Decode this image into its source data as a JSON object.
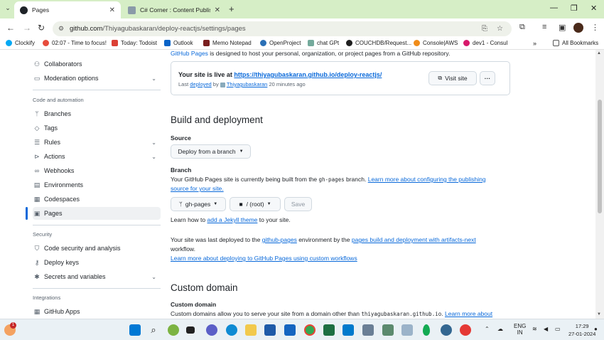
{
  "browser": {
    "tabs": [
      {
        "label": "Pages",
        "active": true
      },
      {
        "label": "C# Corner : Content Publisher",
        "active": false
      }
    ],
    "url_prefix": "github.com",
    "url_path": "/Thiyagubaskaran/deploy-reactjs/settings/pages",
    "bookmarks": [
      "Clockify",
      "02:07 - Time to focus!",
      "Today: Todoist",
      "Outlook",
      "Memo Notepad",
      "OpenProject",
      "chat GPt",
      "COUCHDB/Request...",
      "Console|AWS",
      "dev1 - Consul"
    ],
    "all_bookmarks": "All Bookmarks"
  },
  "sidebar": {
    "top_items": [
      {
        "label": "Collaborators",
        "icon": "people-icon",
        "chevron": false
      },
      {
        "label": "Moderation options",
        "icon": "comment-icon",
        "chevron": true
      }
    ],
    "code_heading": "Code and automation",
    "code_items": [
      {
        "label": "Branches",
        "icon": "branch-icon",
        "chevron": false
      },
      {
        "label": "Tags",
        "icon": "tag-icon",
        "chevron": false
      },
      {
        "label": "Rules",
        "icon": "rules-icon",
        "chevron": true
      },
      {
        "label": "Actions",
        "icon": "play-icon",
        "chevron": true
      },
      {
        "label": "Webhooks",
        "icon": "webhook-icon",
        "chevron": false
      },
      {
        "label": "Environments",
        "icon": "server-icon",
        "chevron": false
      },
      {
        "label": "Codespaces",
        "icon": "codespaces-icon",
        "chevron": false
      },
      {
        "label": "Pages",
        "icon": "browser-icon",
        "chevron": false,
        "selected": true
      }
    ],
    "security_heading": "Security",
    "security_items": [
      {
        "label": "Code security and analysis",
        "icon": "shield-icon",
        "chevron": false
      },
      {
        "label": "Deploy keys",
        "icon": "key-icon",
        "chevron": false
      },
      {
        "label": "Secrets and variables",
        "icon": "asterisk-icon",
        "chevron": true
      }
    ],
    "integrations_heading": "Integrations",
    "integration_items": [
      {
        "label": "GitHub Apps",
        "icon": "apps-icon",
        "chevron": false
      }
    ]
  },
  "main": {
    "cutoff_link": "GitHub Pages",
    "cutoff_text": " is designed to host your personal, organization, or project pages from a GitHub repository.",
    "live_prefix": "Your site is live at ",
    "live_url": "https://thiyagubaskaran.github.io/deploy-reactjs/",
    "meta_last": "Last ",
    "meta_deployed": "deployed",
    "meta_by": " by ",
    "meta_user": "Thiyagubaskaran",
    "meta_time": " 20 minutes ago",
    "visit_site": "Visit site",
    "more": "···",
    "build_heading": "Build and deployment",
    "source_label": "Source",
    "source_value": "Deploy from a branch",
    "branch_label": "Branch",
    "branch_text_1": "Your GitHub Pages site is currently being built from the ",
    "branch_code": "gh-pages",
    "branch_text_2": " branch. ",
    "branch_link": "Learn more about configuring the publishing source for your site.",
    "branch_select": "gh-pages",
    "folder_select": "/ (root)",
    "save": "Save",
    "jekyll_pre": "Learn how to ",
    "jekyll_link": "add a Jekyll theme",
    "jekyll_post": " to your site.",
    "deployed_pre": "Your site was last deployed to the ",
    "deployed_env": "github-pages",
    "deployed_mid": " environment by the ",
    "deployed_wf": "pages build and deployment with artifacts-next",
    "deployed_post": "workflow.",
    "deployed_learn": "Learn more about deploying to GitHub Pages using custom workflows",
    "custom_heading": "Custom domain",
    "custom_label": "Custom domain",
    "custom_text": "Custom domains allow you to serve your site from a domain other than ",
    "custom_code": "thiyagubaskaran.github.io",
    "custom_dot": ". ",
    "custom_link": "Learn more about"
  },
  "taskbar": {
    "lang_1": "ENG",
    "lang_2": "IN",
    "time": "17:29",
    "date": "27-01-2024",
    "notification_count": "1"
  }
}
